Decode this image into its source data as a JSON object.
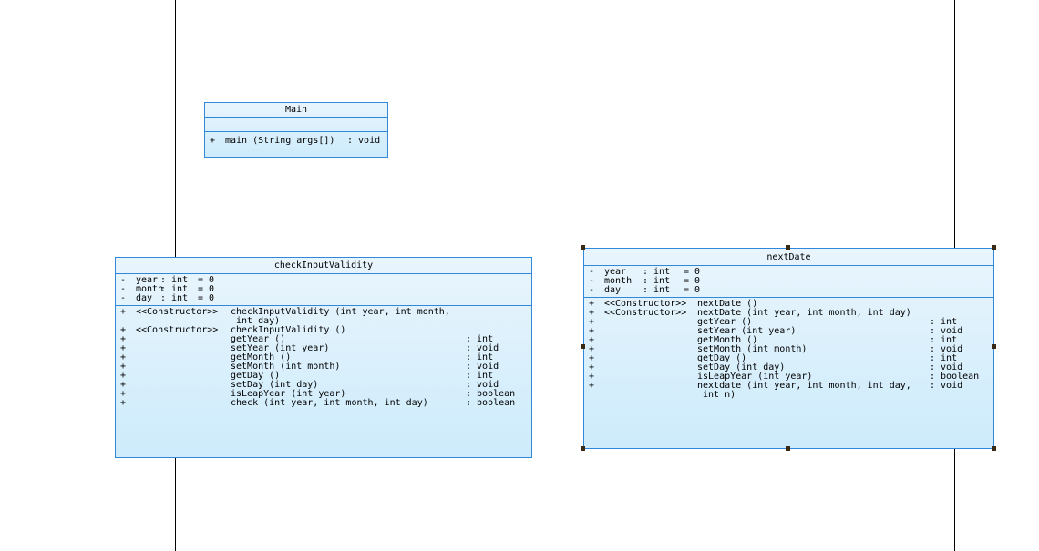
{
  "classes": {
    "main": {
      "name": "Main",
      "attributes": [],
      "operations": [
        {
          "vis": "+",
          "sig": "main (String args[])",
          "ret": ": void"
        }
      ]
    },
    "check": {
      "name": "checkInputValidity",
      "attributes": [
        {
          "vis": "-",
          "name": "year",
          "type": ": int",
          "init": "= 0"
        },
        {
          "vis": "-",
          "name": "month",
          "type": ": int",
          "init": "= 0"
        },
        {
          "vis": "-",
          "name": "day",
          "type": ": int",
          "init": "= 0"
        }
      ],
      "operations": [
        {
          "vis": "+",
          "stereo": "<<Constructor>>",
          "sig": "checkInputValidity (int year, int month,",
          "ret": ""
        },
        {
          "vis": "",
          "stereo": "",
          "sig": " int day)",
          "ret": ""
        },
        {
          "vis": "+",
          "stereo": "<<Constructor>>",
          "sig": "checkInputValidity ()",
          "ret": ""
        },
        {
          "vis": "+",
          "stereo": "",
          "sig": "getYear ()",
          "ret": ": int"
        },
        {
          "vis": "+",
          "stereo": "",
          "sig": "setYear (int year)",
          "ret": ": void"
        },
        {
          "vis": "+",
          "stereo": "",
          "sig": "getMonth ()",
          "ret": ": int"
        },
        {
          "vis": "+",
          "stereo": "",
          "sig": "setMonth (int month)",
          "ret": ": void"
        },
        {
          "vis": "+",
          "stereo": "",
          "sig": "getDay ()",
          "ret": ": int"
        },
        {
          "vis": "+",
          "stereo": "",
          "sig": "setDay (int day)",
          "ret": ": void"
        },
        {
          "vis": "+",
          "stereo": "",
          "sig": "isLeapYear (int year)",
          "ret": ": boolean"
        },
        {
          "vis": "+",
          "stereo": "",
          "sig": "check (int year, int month, int day)",
          "ret": ": boolean"
        }
      ]
    },
    "next": {
      "name": "nextDate",
      "attributes": [
        {
          "vis": "-",
          "name": "year",
          "type": ": int",
          "init": "= 0"
        },
        {
          "vis": "-",
          "name": "month",
          "type": ": int",
          "init": "= 0"
        },
        {
          "vis": "-",
          "name": "day",
          "type": ": int",
          "init": "= 0"
        }
      ],
      "operations": [
        {
          "vis": "+",
          "stereo": "<<Constructor>>",
          "sig": "nextDate ()",
          "ret": ""
        },
        {
          "vis": "+",
          "stereo": "<<Constructor>>",
          "sig": "nextDate (int year, int month, int day)",
          "ret": ""
        },
        {
          "vis": "+",
          "stereo": "",
          "sig": "getYear ()",
          "ret": ": int"
        },
        {
          "vis": "+",
          "stereo": "",
          "sig": "setYear (int year)",
          "ret": ": void"
        },
        {
          "vis": "+",
          "stereo": "",
          "sig": "getMonth ()",
          "ret": ": int"
        },
        {
          "vis": "+",
          "stereo": "",
          "sig": "setMonth (int month)",
          "ret": ": void"
        },
        {
          "vis": "+",
          "stereo": "",
          "sig": "getDay ()",
          "ret": ": int"
        },
        {
          "vis": "+",
          "stereo": "",
          "sig": "setDay (int day)",
          "ret": ": void"
        },
        {
          "vis": "+",
          "stereo": "",
          "sig": "isLeapYear (int year)",
          "ret": ": boolean"
        },
        {
          "vis": "+",
          "stereo": "",
          "sig": "nextdate (int year, int month, int day,",
          "ret": ": void"
        },
        {
          "vis": "",
          "stereo": "",
          "sig": " int n)",
          "ret": ""
        }
      ]
    }
  },
  "colors": {
    "border": "#2f88d8",
    "fill_top": "#e9f5fd",
    "fill_bottom": "#cdebfb",
    "selection_handle": "#3a2a14"
  }
}
